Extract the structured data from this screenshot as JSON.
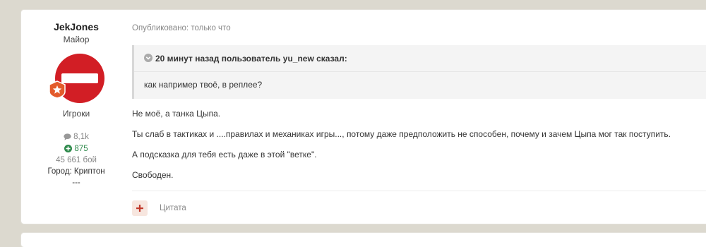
{
  "author": {
    "name": "JekJones",
    "rank": "Майор",
    "group": "Игроки",
    "posts_count": "8,1k",
    "reputation": "875",
    "battles": "45 661 бой",
    "city": "Город: Криптон",
    "extra": "---"
  },
  "post": {
    "published": "Опубликовано: только что",
    "quote": {
      "citation": "20 минут назад пользователь yu_new сказал:",
      "text": "как например твоё, в реплее?"
    },
    "paragraphs": [
      "Не моё, а танка Цыпа.",
      "Ты слаб в тактиках и ....правилах и механиках игры..., потому даже предположить не способен, почему и зачем Цыпа мог так поступить.",
      "А подсказка для тебя есть даже в этой \"ветке\".",
      "Свободен."
    ],
    "quote_action": "Цитата"
  },
  "colors": {
    "background": "#dcd9cf",
    "avatar_red": "#d21e25",
    "rank_badge": "#e35b2c",
    "reputation_green": "#2f8a4c",
    "quote_button_bg": "#f7e6df",
    "quote_button_plus": "#c0392b"
  },
  "icons": {
    "posts": "speech-bubble-icon",
    "reputation": "plus-circle-icon",
    "quote_header": "chevron-circle-icon",
    "quote_button": "plus-icon",
    "badge": "star-icon"
  }
}
